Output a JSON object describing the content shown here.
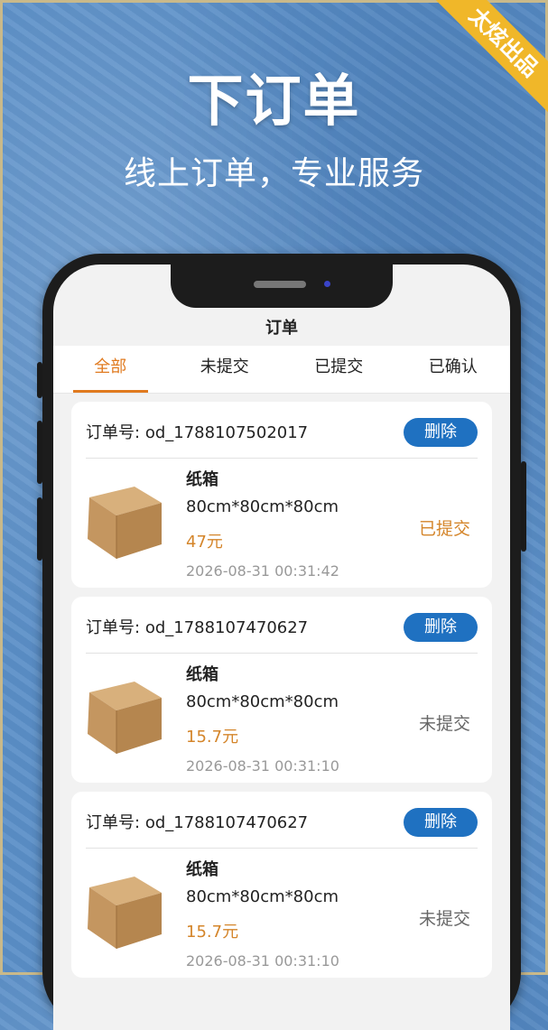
{
  "banner": {
    "headline": "下订单",
    "subline": "线上订单，专业服务",
    "ribbon": "太炫出品"
  },
  "app": {
    "title": "订单",
    "tabs": [
      {
        "label": "全部",
        "active": true
      },
      {
        "label": "未提交",
        "active": false
      },
      {
        "label": "已提交",
        "active": false
      },
      {
        "label": "已确认",
        "active": false
      }
    ]
  },
  "orders": [
    {
      "order_label": "订单号:",
      "order_no": "od_1788107502017",
      "delete_label": "删除",
      "product_name": "纸箱",
      "size": "80cm*80cm*80cm",
      "price": "47元",
      "time": "2026-08-31 00:31:42",
      "status": "已提交",
      "status_color": "#d4852a"
    },
    {
      "order_label": "订单号:",
      "order_no": "od_1788107470627",
      "delete_label": "删除",
      "product_name": "纸箱",
      "size": "80cm*80cm*80cm",
      "price": "15.7元",
      "time": "2026-08-31 00:31:10",
      "status": "未提交",
      "status_color": "#666666"
    },
    {
      "order_label": "订单号:",
      "order_no": "od_1788107470627",
      "delete_label": "删除",
      "product_name": "纸箱",
      "size": "80cm*80cm*80cm",
      "price": "15.7元",
      "time": "2026-08-31 00:31:10",
      "status": "未提交",
      "status_color": "#666666"
    }
  ],
  "colors": {
    "accent": "#e07a1f",
    "button": "#1f71c1",
    "background": "#5b8fc8"
  },
  "icons": {
    "product": "cardboard-box-icon"
  }
}
